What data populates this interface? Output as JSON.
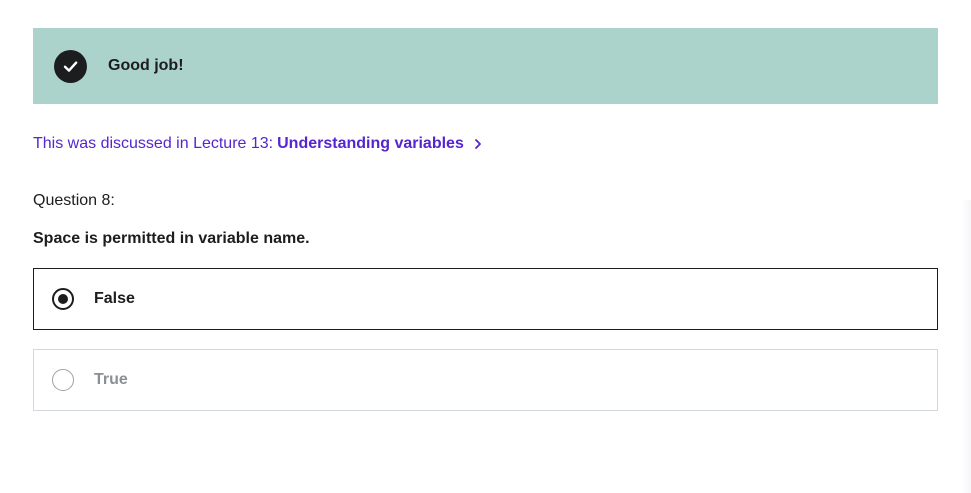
{
  "feedback": {
    "message": "Good job!",
    "icon": "check-icon",
    "background_color": "#acd2cc"
  },
  "lecture_reference": {
    "prefix": "This was discussed in Lecture 13:",
    "link_label": "Understanding variables",
    "icon": "chevron-right-icon",
    "link_color": "#5624d0"
  },
  "question": {
    "number_label": "Question 8:",
    "text": "Space is permitted in variable name."
  },
  "options": [
    {
      "label": "False",
      "selected": true
    },
    {
      "label": "True",
      "selected": false
    }
  ]
}
